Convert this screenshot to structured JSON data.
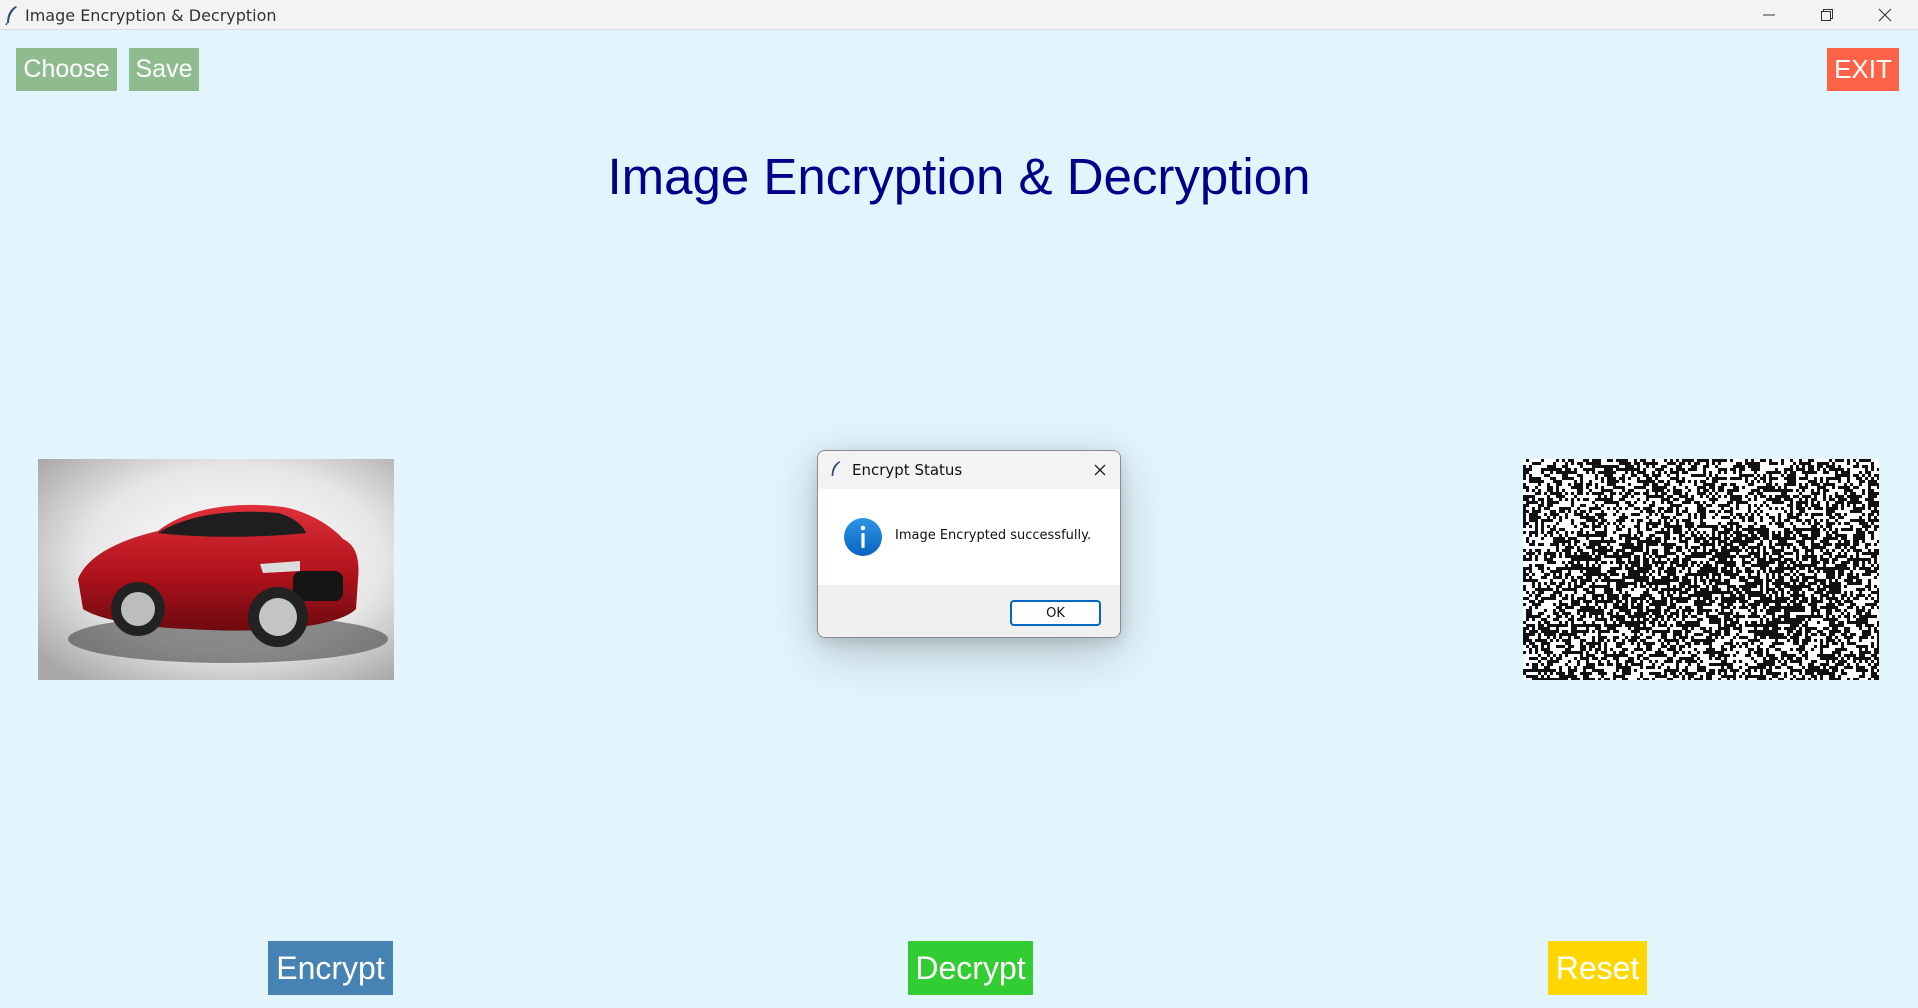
{
  "window": {
    "title": "Image Encryption & Decryption"
  },
  "toolbar": {
    "choose_label": "Choose",
    "save_label": "Save",
    "exit_label": "EXIT"
  },
  "main": {
    "title": "Image Encryption & Decryption",
    "original_image": "red-sedan-car-photo",
    "encrypted_image": "noise-scrambled-car-image"
  },
  "actions": {
    "encrypt_label": "Encrypt",
    "decrypt_label": "Decrypt",
    "reset_label": "Reset"
  },
  "dialog": {
    "title": "Encrypt Status",
    "message": "Image Encrypted successfully.",
    "ok_label": "OK",
    "icon": "info-icon"
  },
  "colors": {
    "background": "#e2f5fd",
    "choose_save_bg": "#8fbc8f",
    "exit_bg": "#ff6347",
    "title_text": "#00008b",
    "encrypt_bg": "#4682b4",
    "decrypt_bg": "#32cd32",
    "reset_bg": "#ffd700"
  }
}
